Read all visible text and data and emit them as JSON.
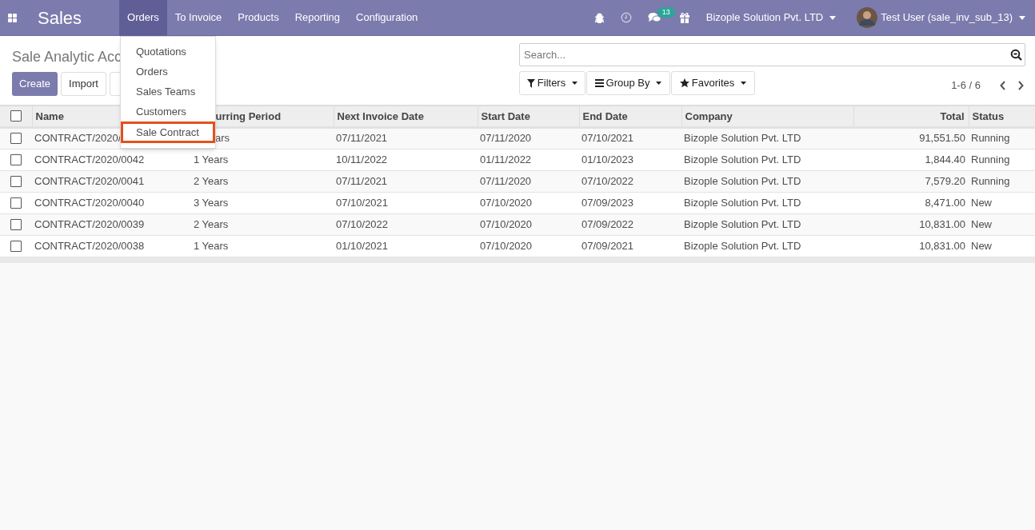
{
  "navbar": {
    "app": "Sales",
    "menus": [
      {
        "label": "Orders",
        "selected": true
      },
      {
        "label": "To Invoice",
        "selected": false
      },
      {
        "label": "Products",
        "selected": false
      },
      {
        "label": "Reporting",
        "selected": false
      },
      {
        "label": "Configuration",
        "selected": false
      }
    ],
    "message_count": "13",
    "company": "Bizople Solution Pvt. LTD",
    "user": "Test User (sale_inv_sub_13)"
  },
  "dropdown": {
    "items": [
      {
        "label": "Quotations",
        "selected": false
      },
      {
        "label": "Orders",
        "selected": false
      },
      {
        "label": "Sales Teams",
        "selected": false
      },
      {
        "label": "Customers",
        "selected": false
      },
      {
        "label": "Sale Contract",
        "selected": true
      }
    ]
  },
  "control_panel": {
    "title": "Sale Analytic Acc",
    "buttons": [
      "Create",
      "Import"
    ],
    "search": {
      "placeholder": "Search..."
    },
    "filters": [
      "Filters",
      "Group By",
      "Favorites"
    ],
    "pager": "1-6 / 6"
  },
  "table": {
    "select_all_checked": false,
    "columns": [
      "Name",
      "urring Period",
      "Next Invoice Date",
      "Start Date",
      "End Date",
      "Company",
      "Total",
      "Status"
    ],
    "rows": [
      {
        "checked": false,
        "cells": [
          "CONTRACT/2020/",
          "ars",
          "07/11/2021",
          "07/11/2020",
          "07/10/2021",
          "Bizople Solution Pvt. LTD",
          "91,551.50",
          "Running"
        ]
      },
      {
        "checked": false,
        "cells": [
          "CONTRACT/2020/0042",
          "1 Years",
          "10/11/2022",
          "01/11/2022",
          "01/10/2023",
          "Bizople Solution Pvt. LTD",
          "1,844.40",
          "Running"
        ]
      },
      {
        "checked": false,
        "cells": [
          "CONTRACT/2020/0041",
          "2 Years",
          "07/11/2021",
          "07/11/2020",
          "07/10/2022",
          "Bizople Solution Pvt. LTD",
          "7,579.20",
          "Running"
        ]
      },
      {
        "checked": false,
        "cells": [
          "CONTRACT/2020/0040",
          "3 Years",
          "07/10/2021",
          "07/10/2020",
          "07/09/2023",
          "Bizople Solution Pvt. LTD",
          "8,471.00",
          "New"
        ]
      },
      {
        "checked": false,
        "cells": [
          "CONTRACT/2020/0039",
          "2 Years",
          "07/10/2022",
          "07/10/2020",
          "07/09/2022",
          "Bizople Solution Pvt. LTD",
          "10,831.00",
          "New"
        ]
      },
      {
        "checked": false,
        "cells": [
          "CONTRACT/2020/0038",
          "1 Years",
          "01/10/2021",
          "07/10/2020",
          "07/09/2021",
          "Bizople Solution Pvt. LTD",
          "10,831.00",
          "New"
        ]
      }
    ]
  }
}
